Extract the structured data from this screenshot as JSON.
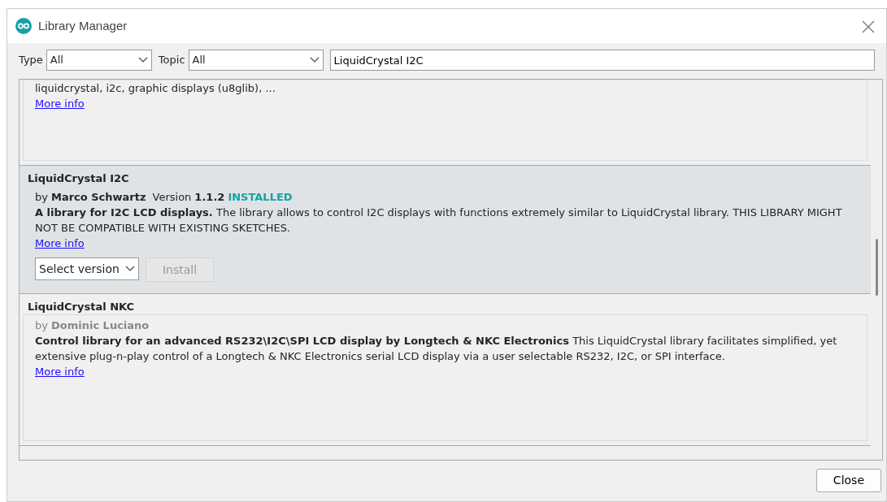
{
  "window": {
    "title": "Library Manager"
  },
  "filters": {
    "type_label": "Type",
    "type_value": "All",
    "topic_label": "Topic",
    "topic_value": "All",
    "search_value": "LiquidCrystal I2C"
  },
  "libraries": [
    {
      "selected": false,
      "description": "liquidcrystal, i2c, graphic displays (u8glib), ...",
      "more_info": "More info"
    },
    {
      "selected": true,
      "title": "LiquidCrystal I2C",
      "by": "by",
      "author": "Marco Schwartz",
      "version_label": "Version",
      "version": "1.1.2",
      "status": "INSTALLED",
      "description": "**A library for I2C LCD displays.** The library allows to control I2C displays with functions extremely similar to LiquidCrystal library. THIS LIBRARY MIGHT NOT BE COMPATIBLE WITH EXISTING SKETCHES.",
      "more_info": "More info",
      "version_select": "Select version",
      "install_button": {
        "label": "Install",
        "disabled": true
      }
    },
    {
      "selected": false,
      "title": "LiquidCrystal NKC",
      "by": "by",
      "author": "Dominic Luciano",
      "description": "**Control library for an advanced RS232\\I2C\\SPI LCD display by Longtech & NKC Electronics** This LiquidCrystal library facilitates simplified, yet extensive plug-n-play control of a Longtech & NKC Electronics serial LCD display via a user selectable RS232, I2C, or SPI interface.",
      "more_info": "More info"
    }
  ],
  "close_button": "Close"
}
